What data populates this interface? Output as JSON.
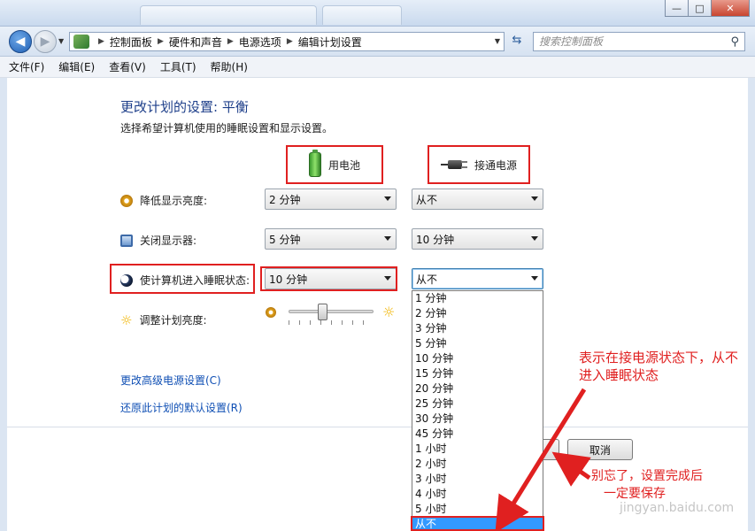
{
  "window": {
    "minimize_glyph": "—",
    "maximize_glyph": "□",
    "close_glyph": "✕"
  },
  "navigation": {
    "back_glyph": "◀",
    "forward_glyph": "▶",
    "breadcrumbs": [
      "控制面板",
      "硬件和声音",
      "电源选项",
      "编辑计划设置"
    ],
    "search_placeholder": "搜索控制面板",
    "search_icon": "search-icon",
    "refresh_icon": "refresh-icon"
  },
  "menu": [
    "文件(F)",
    "编辑(E)",
    "查看(V)",
    "工具(T)",
    "帮助(H)"
  ],
  "page": {
    "title": "更改计划的设置: 平衡",
    "subtitle": "选择希望计算机使用的睡眠设置和显示设置。",
    "columns": {
      "battery": "用电池",
      "plugged_in": "接通电源"
    },
    "rows": [
      {
        "label": "降低显示亮度:",
        "icon": "dim-display-icon",
        "battery": "2 分钟",
        "plugged_in": "从不"
      },
      {
        "label": "关闭显示器:",
        "icon": "monitor-icon",
        "battery": "5 分钟",
        "plugged_in": "10 分钟"
      },
      {
        "label": "使计算机进入睡眠状态:",
        "icon": "moon-icon",
        "battery": "10 分钟",
        "plugged_in": "从不"
      }
    ],
    "brightness_label": "调整计划亮度:",
    "brightness_level": 0.4,
    "links": {
      "advanced": "更改高级电源设置(C)",
      "restore": "还原此计划的默认设置(R)"
    },
    "buttons": {
      "cancel": "取消"
    }
  },
  "dropdown_options": [
    "1 分钟",
    "2 分钟",
    "3 分钟",
    "5 分钟",
    "10 分钟",
    "15 分钟",
    "20 分钟",
    "25 分钟",
    "30 分钟",
    "45 分钟",
    "1 小时",
    "2 小时",
    "3 小时",
    "4 小时",
    "5 小时",
    "从不"
  ],
  "dropdown_selected": "从不",
  "annotations": {
    "note1_line1": "表示在接电源状态下，从不",
    "note1_line2": "进入睡眠状态",
    "note2_line1": "别忘了，设置完成后",
    "note2_line2": "一定要保存"
  },
  "watermark": "jingyan.baidu.com",
  "colors": {
    "highlight_red": "#e02020",
    "link_blue": "#0f4fb4",
    "selected_blue": "#3399ff",
    "heading_blue": "#1e3f8a"
  }
}
